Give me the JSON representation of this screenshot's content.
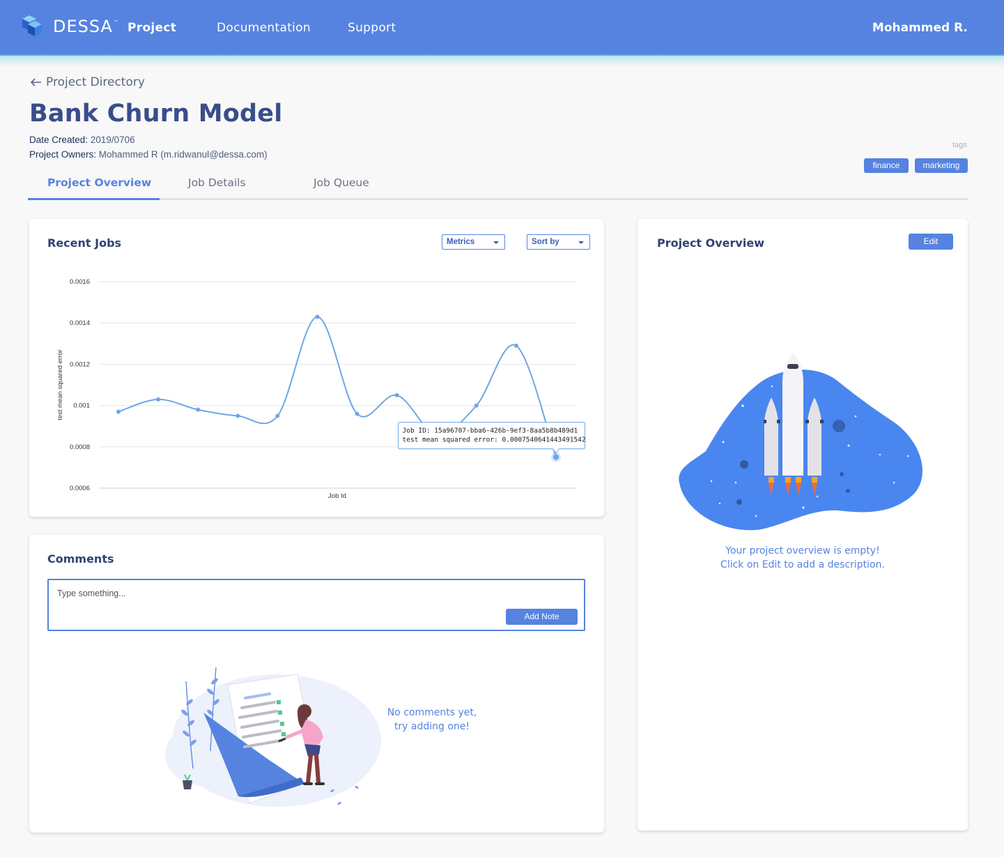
{
  "header": {
    "brand": "DESSA",
    "brand_tm": "™",
    "nav": [
      {
        "label": "Project"
      },
      {
        "label": "Documentation"
      },
      {
        "label": "Support"
      }
    ],
    "user": "Mohammed R."
  },
  "page": {
    "back_label": "Project Directory",
    "title": "Bank Churn Model",
    "date_created_label": "Date Created:",
    "date_created_value": "2019/0706",
    "owners_label": "Project Owners:",
    "owners_value": "Mohammed R (m.ridwanul@dessa.com)",
    "tags_label": "tags",
    "tags": [
      "finance",
      "marketing"
    ]
  },
  "tabs": [
    {
      "label": "Project Overview",
      "active": true
    },
    {
      "label": "Job Details",
      "active": false
    },
    {
      "label": "Job Queue",
      "active": false
    }
  ],
  "recent_jobs": {
    "title": "Recent Jobs",
    "metrics_dropdown": "Metrics",
    "sort_dropdown": "Sort by"
  },
  "chart_data": {
    "type": "line",
    "title": "",
    "xlabel": "Job Id",
    "ylabel": "test mean squared error",
    "ylim": [
      0.0006,
      0.0016
    ],
    "yticks": [
      "0.0016",
      "0.0014",
      "0.0012",
      "0.001",
      "0.0008",
      "0.0006"
    ],
    "grid": true,
    "series": [
      {
        "values": [
          0.00097,
          0.00103,
          0.00098,
          0.00095,
          0.00095,
          0.00143,
          0.00096,
          0.00105,
          0.00086,
          0.001,
          0.00129,
          0.00075
        ]
      }
    ],
    "tooltip": {
      "line1": "Job ID: 15a96707-bba6-426b-9ef3-8aa5b8b489d1",
      "line2": "test mean squared error: 0.0007540641443491542",
      "point_index": 11
    },
    "color": "#6fa6e3"
  },
  "comments": {
    "title": "Comments",
    "placeholder": "Type something...",
    "add_button": "Add Note",
    "empty_line1": "No comments yet,",
    "empty_line2": "try adding one!"
  },
  "overview": {
    "title": "Project Overview",
    "edit_button": "Edit",
    "empty_line1": "Your project overview is empty!",
    "empty_line2": "Click on Edit to add a description."
  },
  "colors": {
    "primary": "#5583df",
    "title": "#3a4d8a",
    "line": "#6fa6e3"
  }
}
